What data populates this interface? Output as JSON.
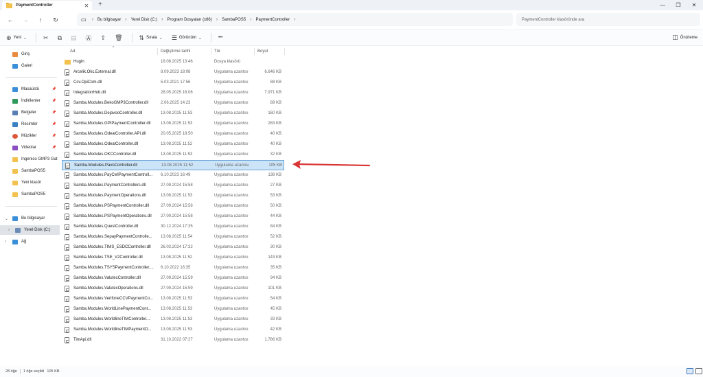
{
  "window": {
    "tab_title": "PaymentController",
    "new_tab": "+",
    "minimize": "—",
    "maximize": "❐",
    "close": "✕"
  },
  "nav": {
    "crumbs": [
      "Bu bilgisayar",
      "Yerel Disk (C:)",
      "Program Dosyaları (x86)",
      "SambaPOS5",
      "PaymentController"
    ],
    "search_placeholder": "PaymentController klasöründe ara"
  },
  "toolbar": {
    "new_label": "Yeni",
    "sort_label": "Sırala",
    "view_label": "Görünüm",
    "more_label": "•••",
    "preview_label": "Önizleme"
  },
  "sidebar": {
    "top_items": [
      {
        "label": "Giriş",
        "icon": "home-icon",
        "color": "#e98a3c"
      },
      {
        "label": "Galeri",
        "icon": "gallery-icon",
        "color": "#3a8fd8"
      }
    ],
    "quick_items": [
      {
        "label": "Masaüstü",
        "icon": "desktop-icon",
        "color": "#3a8fd8",
        "pinned": true
      },
      {
        "label": "İndirilenler",
        "icon": "downloads-icon",
        "color": "#2f9a5a",
        "pinned": true
      },
      {
        "label": "Belgeler",
        "icon": "documents-icon",
        "color": "#5a7fb5",
        "pinned": true
      },
      {
        "label": "Resimler",
        "icon": "pictures-icon",
        "color": "#3b82c4",
        "pinned": true
      },
      {
        "label": "Müzikler",
        "icon": "music-icon",
        "color": "#e0573a",
        "pinned": true
      },
      {
        "label": "Videolar",
        "icon": "videos-icon",
        "color": "#8a4fc2",
        "pinned": true
      },
      {
        "label": "Ingenico GMP3 Gat",
        "icon": "folder-icon",
        "color": "#f2c14e",
        "pinned": false
      },
      {
        "label": "SambaPOS5",
        "icon": "folder-icon",
        "color": "#f2c14e",
        "pinned": false
      },
      {
        "label": "Yeni klasör",
        "icon": "folder-icon",
        "color": "#f2c14e",
        "pinned": false
      },
      {
        "label": "SambaPOS5",
        "icon": "folder-icon",
        "color": "#f2c14e",
        "pinned": false
      }
    ],
    "tree_items": [
      {
        "label": "Bu bilgisayar",
        "icon": "computer-icon",
        "color": "#3a8fd8"
      },
      {
        "label": "Yerel Disk (C:)",
        "icon": "drive-icon",
        "color": "#6b8db5"
      },
      {
        "label": "Ağ",
        "icon": "network-icon",
        "color": "#3a8fd8"
      }
    ]
  },
  "columns": {
    "name": "Ad",
    "date": "Değiştirme tarihi",
    "type": "Tür",
    "size": "Boyut"
  },
  "files": [
    {
      "name": "Hugin",
      "date": "18.08.2025 13:46",
      "type": "Dosya klasörü",
      "size": "",
      "folder": true
    },
    {
      "name": "Arcelik.Okc.External.dll",
      "date": "8.09.2023 18:08",
      "type": "Uygulama uzantısı",
      "size": "6.646 KB"
    },
    {
      "name": "Ccv.OpiCom.dll",
      "date": "5.03.2021 17:56",
      "type": "Uygulama uzantısı",
      "size": "88 KB"
    },
    {
      "name": "IntegrationHub.dll",
      "date": "28.05.2025 16:06",
      "type": "Uygulama uzantısı",
      "size": "7.971 KB"
    },
    {
      "name": "Samba.Modules.BekoGMP3Controller.dll",
      "date": "2.06.2025 14:23",
      "type": "Uygulama uzantısı",
      "size": "89 KB"
    },
    {
      "name": "Samba.Modules.DejavooController.dll",
      "date": "13.08.2025 11:53",
      "type": "Uygulama uzantısı",
      "size": "160 KB"
    },
    {
      "name": "Samba.Modules.GPIPaymentController.dll",
      "date": "13.08.2025 11:53",
      "type": "Uygulama uzantısı",
      "size": "283 KB"
    },
    {
      "name": "Samba.Modules.OdealController.API.dll",
      "date": "20.05.2025 18:50",
      "type": "Uygulama uzantısı",
      "size": "40 KB"
    },
    {
      "name": "Samba.Modules.OdealController.dll",
      "date": "13.08.2025 11:52",
      "type": "Uygulama uzantısı",
      "size": "40 KB"
    },
    {
      "name": "Samba.Modules.OKCController.dll",
      "date": "13.08.2025 11:53",
      "type": "Uygulama uzantısı",
      "size": "32 KB"
    },
    {
      "name": "Samba.Modules.PavoController.dll",
      "date": "13.08.2025 11:52",
      "type": "Uygulama uzantısı",
      "size": "105 KB",
      "selected": true
    },
    {
      "name": "Samba.Modules.PayCellPaymentControll...",
      "date": "6.10.2023 16:49",
      "type": "Uygulama uzantısı",
      "size": "138 KB"
    },
    {
      "name": "Samba.Modules.PaymentControllers.dll",
      "date": "27.09.2024 15:58",
      "type": "Uygulama uzantısı",
      "size": "27 KB"
    },
    {
      "name": "Samba.Modules.PaymentOperations.dll",
      "date": "13.08.2025 11:53",
      "type": "Uygulama uzantısı",
      "size": "53 KB"
    },
    {
      "name": "Samba.Modules.PSPaymentController.dll",
      "date": "27.09.2024 15:58",
      "type": "Uygulama uzantısı",
      "size": "50 KB"
    },
    {
      "name": "Samba.Modules.PSPaymentOperations.dll",
      "date": "27.09.2024 15:58",
      "type": "Uygulama uzantısı",
      "size": "44 KB"
    },
    {
      "name": "Samba.Modules.QuestController.dll",
      "date": "30.12.2024 17:35",
      "type": "Uygulama uzantısı",
      "size": "84 KB"
    },
    {
      "name": "Samba.Modules.SepayPaymentControlle...",
      "date": "13.08.2025 11:54",
      "type": "Uygulama uzantısı",
      "size": "52 KB"
    },
    {
      "name": "Samba.Modules.TIMS_ESDCController.dll",
      "date": "26.03.2024 17:32",
      "type": "Uygulama uzantısı",
      "size": "30 KB"
    },
    {
      "name": "Samba.Modules.TSE_V2Controller.dll",
      "date": "13.08.2025 11:52",
      "type": "Uygulama uzantısı",
      "size": "143 KB"
    },
    {
      "name": "Samba.Modules.TSYSPaymentController....",
      "date": "6.10.2022 16:35",
      "type": "Uygulama uzantısı",
      "size": "35 KB"
    },
    {
      "name": "Samba.Modules.ValutecController.dll",
      "date": "27.09.2024 15:59",
      "type": "Uygulama uzantısı",
      "size": "94 KB"
    },
    {
      "name": "Samba.Modules.ValutecOperations.dll",
      "date": "27.09.2024 15:59",
      "type": "Uygulama uzantısı",
      "size": "101 KB"
    },
    {
      "name": "Samba.Modules.VerifoneCCVPaymentCo...",
      "date": "13.08.2025 11:53",
      "type": "Uygulama uzantısı",
      "size": "54 KB"
    },
    {
      "name": "Samba.Modules.WorldLinePaymentCont...",
      "date": "13.08.2025 11:53",
      "type": "Uygulama uzantısı",
      "size": "45 KB"
    },
    {
      "name": "Samba.Modules.WorldlineTIMController....",
      "date": "13.08.2025 11:53",
      "type": "Uygulama uzantısı",
      "size": "33 KB"
    },
    {
      "name": "Samba.Modules.WorldlineTIMPaymentO...",
      "date": "13.08.2025 11:53",
      "type": "Uygulama uzantısı",
      "size": "42 KB"
    },
    {
      "name": "TimApi.dll",
      "date": "31.10.2022 07:27",
      "type": "Uygulama uzantısı",
      "size": "1.786 KB"
    }
  ],
  "status": {
    "count": "28 öğe",
    "selection": "1 öğe seçildi",
    "size": "105 KB"
  },
  "colors": {
    "accent": "#3a77c2",
    "selected_row": "#cce4f7",
    "annotation_arrow": "#d93535"
  }
}
